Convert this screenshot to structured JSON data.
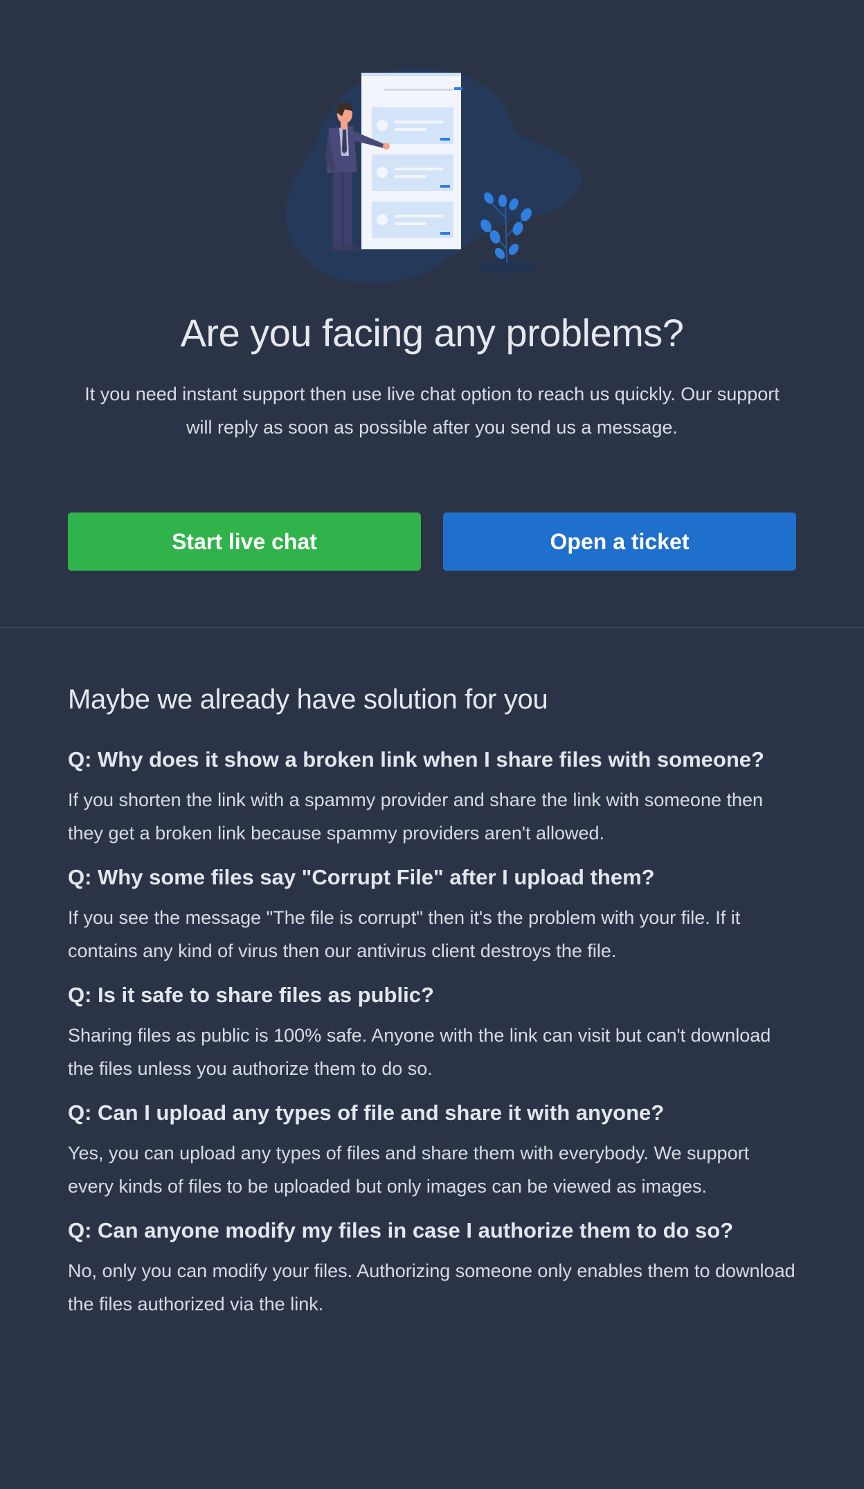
{
  "hero": {
    "title": "Are you facing any problems?",
    "description": "It you need instant support then use live chat option to reach us quickly. Our support will reply as soon as possible after you send us a message.",
    "chat_button_label": "Start live chat",
    "ticket_button_label": "Open a ticket"
  },
  "faq": {
    "heading": "Maybe we already have solution for you",
    "items": [
      {
        "question": "Q: Why does it show a broken link when I share files with someone?",
        "answer": "If you shorten the link with a spammy provider and share the link with someone then they get a broken link because spammy providers aren't allowed."
      },
      {
        "question": "Q: Why some files say \"Corrupt File\" after I upload them?",
        "answer": "If you see the message \"The file is corrupt\" then it's the problem with your file. If it contains any kind of virus then our antivirus client destroys the file."
      },
      {
        "question": "Q: Is it safe to share files as public?",
        "answer": "Sharing files as public is 100% safe. Anyone with the link can visit but can't download the files unless you authorize them to do so."
      },
      {
        "question": "Q: Can I upload any types of file and share it with anyone?",
        "answer": "Yes, you can upload any types of files and share them with everybody. We support every kinds of files to be uploaded but only images can be viewed as images."
      },
      {
        "question": "Q: Can anyone modify my files in case I authorize them to do so?",
        "answer": "No, only you can modify your files. Authorizing someone only enables them to download the files authorized via the link."
      }
    ]
  },
  "colors": {
    "background": "#2b3447",
    "chat_button": "#30b34a",
    "ticket_button": "#1f6fcc",
    "accent_blue": "#2f7ee0"
  },
  "icons": {
    "illustration": "support-illustration"
  }
}
